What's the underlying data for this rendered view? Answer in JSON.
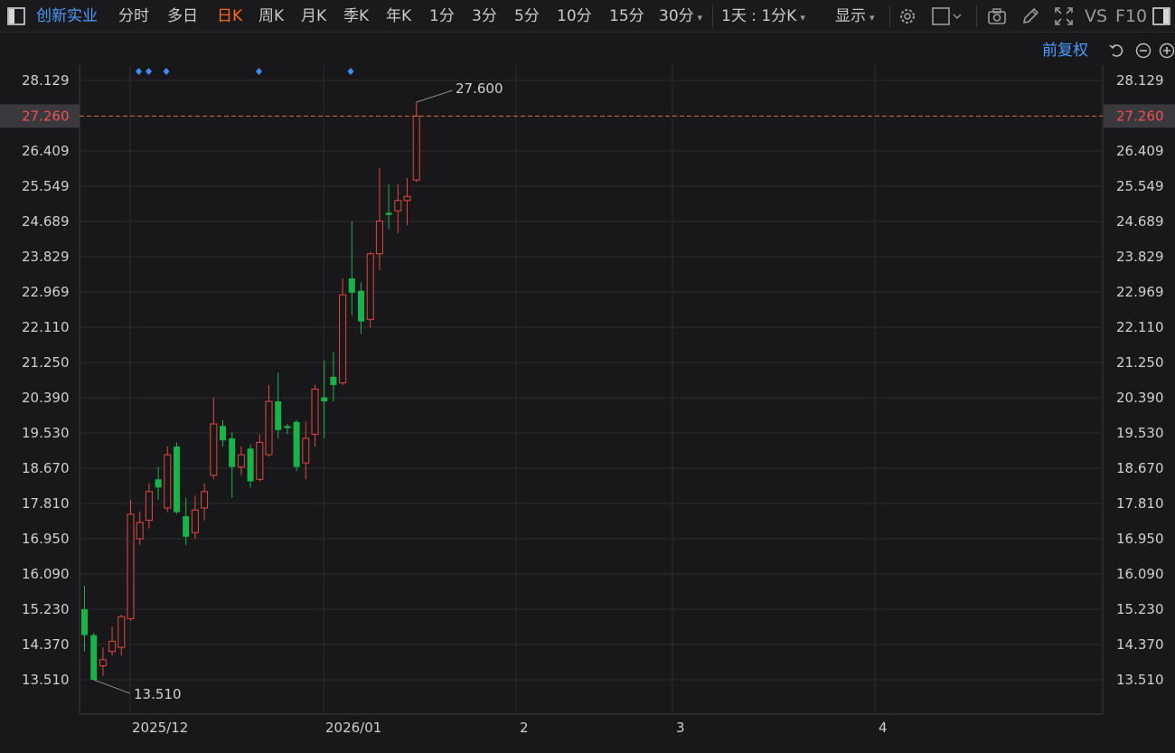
{
  "toolbar": {
    "menu_icon": "panel-toggle-icon",
    "stock_name": "创新实业",
    "periods": [
      "分时",
      "多日",
      "日K",
      "周K",
      "月K",
      "季K",
      "年K",
      "1分",
      "3分",
      "5分",
      "10分",
      "15分"
    ],
    "active_period": "日K",
    "minute_dropdown": "30分",
    "range_dropdown": "1天 : 1分K",
    "display_dropdown": "显示",
    "vs_label": "VS",
    "f10_label": "F10",
    "icons": [
      "settings-icon",
      "layout-icon",
      "camera-icon",
      "pencil-icon",
      "fullscreen-icon",
      "sidebar-toggle-icon"
    ]
  },
  "subbar": {
    "adjust_label": "前复权",
    "icons": [
      "undo-icon",
      "zoom-out-icon",
      "zoom-in-icon"
    ]
  },
  "colors": {
    "up": "#e5473d",
    "down": "#19b449",
    "background": "#18181a",
    "grid": "#2c2c2e",
    "price_line": "#e0722e",
    "price_tag": "#f05050",
    "marker": "#3f8cff",
    "title": "#4c9cff",
    "active": "#ff6a1a"
  },
  "chart_data": {
    "type": "candlestick",
    "y_ticks": [
      "28.129",
      "27.260",
      "26.409",
      "25.549",
      "24.689",
      "23.829",
      "22.969",
      "22.110",
      "21.250",
      "20.390",
      "19.530",
      "18.670",
      "17.810",
      "16.950",
      "16.090",
      "15.230",
      "14.370",
      "13.510"
    ],
    "x_labels": [
      "2025/12",
      "2026/01",
      "2",
      "3",
      "4"
    ],
    "current_price": "27.260",
    "high_annotation": "27.600",
    "low_annotation": "13.510",
    "ylim": [
      13.51,
      28.129
    ],
    "grid": true,
    "event_marker_count": 5,
    "candles": [
      {
        "o": 15.23,
        "h": 15.8,
        "l": 14.2,
        "c": 14.6
      },
      {
        "o": 14.6,
        "h": 14.65,
        "l": 13.51,
        "c": 13.51
      },
      {
        "o": 13.85,
        "h": 14.3,
        "l": 13.6,
        "c": 14.0
      },
      {
        "o": 14.2,
        "h": 14.8,
        "l": 14.1,
        "c": 14.45
      },
      {
        "o": 14.3,
        "h": 15.1,
        "l": 14.1,
        "c": 15.05
      },
      {
        "o": 15.0,
        "h": 17.9,
        "l": 14.95,
        "c": 17.55
      },
      {
        "o": 16.95,
        "h": 17.6,
        "l": 16.8,
        "c": 17.35
      },
      {
        "o": 17.4,
        "h": 18.3,
        "l": 17.2,
        "c": 18.1
      },
      {
        "o": 18.4,
        "h": 18.7,
        "l": 17.9,
        "c": 18.2
      },
      {
        "o": 17.7,
        "h": 19.2,
        "l": 17.6,
        "c": 19.0
      },
      {
        "o": 19.2,
        "h": 19.3,
        "l": 17.55,
        "c": 17.6
      },
      {
        "o": 17.5,
        "h": 17.95,
        "l": 16.8,
        "c": 17.0
      },
      {
        "o": 17.1,
        "h": 18.0,
        "l": 16.95,
        "c": 17.65
      },
      {
        "o": 17.7,
        "h": 18.3,
        "l": 17.4,
        "c": 18.1
      },
      {
        "o": 18.5,
        "h": 20.4,
        "l": 18.4,
        "c": 19.75
      },
      {
        "o": 19.7,
        "h": 19.85,
        "l": 19.2,
        "c": 19.35
      },
      {
        "o": 19.4,
        "h": 19.55,
        "l": 17.95,
        "c": 18.7
      },
      {
        "o": 18.7,
        "h": 19.2,
        "l": 18.5,
        "c": 19.0
      },
      {
        "o": 19.15,
        "h": 19.25,
        "l": 18.2,
        "c": 18.35
      },
      {
        "o": 18.4,
        "h": 19.5,
        "l": 18.35,
        "c": 19.3
      },
      {
        "o": 19.0,
        "h": 20.7,
        "l": 18.95,
        "c": 20.3
      },
      {
        "o": 20.3,
        "h": 21.0,
        "l": 19.4,
        "c": 19.6
      },
      {
        "o": 19.7,
        "h": 19.75,
        "l": 19.5,
        "c": 19.65
      },
      {
        "o": 19.8,
        "h": 19.85,
        "l": 18.6,
        "c": 18.7
      },
      {
        "o": 18.8,
        "h": 19.8,
        "l": 18.4,
        "c": 19.4
      },
      {
        "o": 19.5,
        "h": 20.7,
        "l": 19.2,
        "c": 20.6
      },
      {
        "o": 20.4,
        "h": 21.3,
        "l": 19.4,
        "c": 20.3
      },
      {
        "o": 20.9,
        "h": 21.5,
        "l": 20.3,
        "c": 20.7
      },
      {
        "o": 20.75,
        "h": 23.3,
        "l": 20.7,
        "c": 22.9
      },
      {
        "o": 23.3,
        "h": 24.7,
        "l": 22.4,
        "c": 22.95
      },
      {
        "o": 23.0,
        "h": 23.2,
        "l": 21.95,
        "c": 22.25
      },
      {
        "o": 22.3,
        "h": 23.95,
        "l": 22.1,
        "c": 23.9
      },
      {
        "o": 23.9,
        "h": 26.0,
        "l": 23.5,
        "c": 24.7
      },
      {
        "o": 24.9,
        "h": 25.6,
        "l": 24.5,
        "c": 24.85
      },
      {
        "o": 24.95,
        "h": 25.6,
        "l": 24.4,
        "c": 25.2
      },
      {
        "o": 25.2,
        "h": 25.75,
        "l": 24.6,
        "c": 25.3
      },
      {
        "o": 25.7,
        "h": 27.6,
        "l": 25.65,
        "c": 27.26
      }
    ]
  }
}
